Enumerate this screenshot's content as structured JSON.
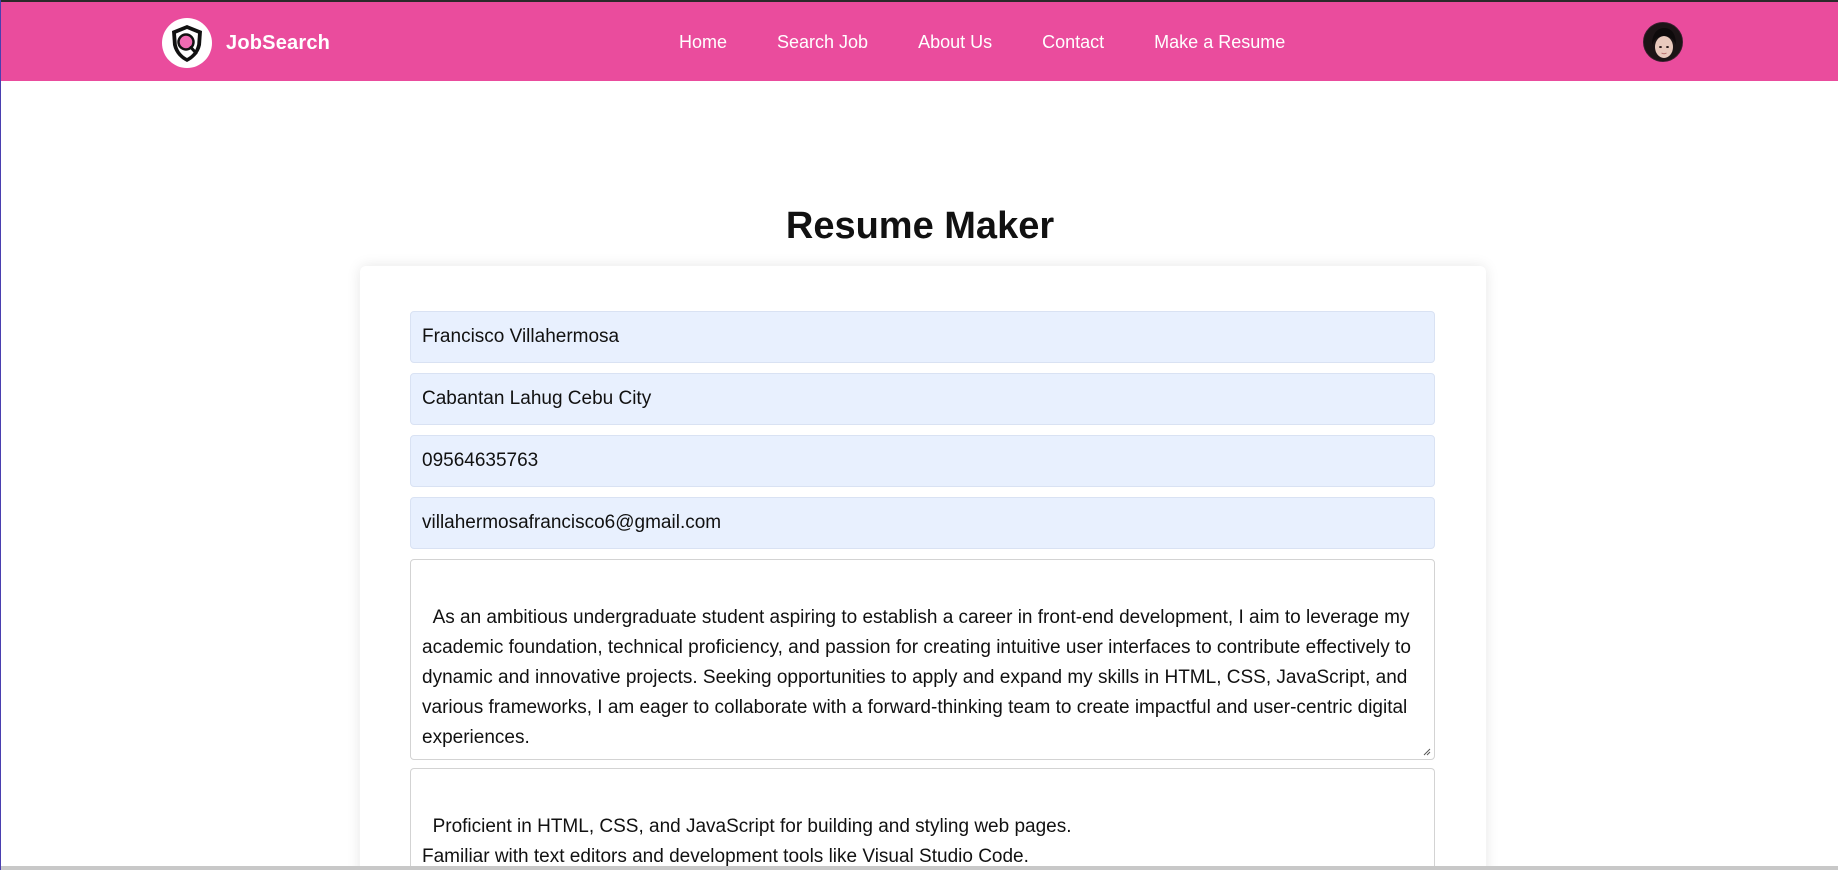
{
  "brand": {
    "name": "JobSearch",
    "icon": "shield-search-icon",
    "color": "#ea4c9d"
  },
  "nav": {
    "items": [
      {
        "label": "Home"
      },
      {
        "label": "Search Job"
      },
      {
        "label": "About Us"
      },
      {
        "label": "Contact"
      },
      {
        "label": "Make a Resume"
      }
    ]
  },
  "user": {
    "avatar": "user-avatar"
  },
  "page": {
    "title": "Resume Maker"
  },
  "form": {
    "name": "Francisco Villahermosa",
    "address": "Cabantan Lahug Cebu City",
    "phone": "09564635763",
    "email": "villahermosafrancisco6@gmail.com",
    "objective": "As an ambitious undergraduate student aspiring to establish a career in front-end development, I aim to leverage my academic foundation, technical proficiency, and passion for creating intuitive user interfaces to contribute effectively to dynamic and innovative projects. Seeking opportunities to apply and expand my skills in HTML, CSS, JavaScript, and various frameworks, I am eager to collaborate with a forward-thinking team to create impactful and user-centric digital experiences.",
    "skills": "Proficient in HTML, CSS, and JavaScript for building and styling web pages.\nFamiliar with text editors and development tools like Visual Studio Code.\nMid-level experience with React.js for creating interactive user interfaces."
  }
}
